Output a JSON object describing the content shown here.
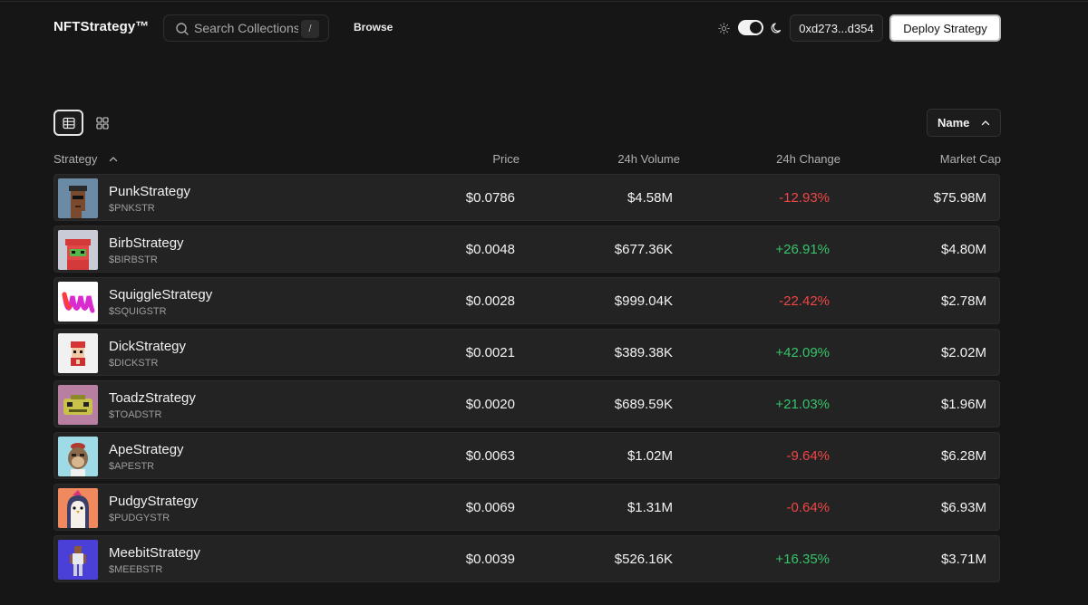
{
  "header": {
    "brand": "NFTStrategy™",
    "search_placeholder": "Search Collections",
    "search_shortcut": "/",
    "browse_label": "Browse",
    "wallet_address": "0xd273...d354",
    "deploy_label": "Deploy Strategy",
    "theme_dark": true
  },
  "toolbar": {
    "sort_label": "Name",
    "view_mode": "table"
  },
  "table": {
    "columns": {
      "strategy": "Strategy",
      "price": "Price",
      "volume": "24h Volume",
      "change": "24h Change",
      "market_cap": "Market Cap"
    },
    "rows": [
      {
        "name": "PunkStrategy",
        "ticker": "$PNKSTR",
        "price": "$0.0786",
        "volume": "$4.58M",
        "change": "-12.93%",
        "direction": "down",
        "market_cap": "$75.98M",
        "avatar_icon": "cryptopunk-avatar-icon",
        "avatar_bg": "#6b8aa6"
      },
      {
        "name": "BirbStrategy",
        "ticker": "$BIRBSTR",
        "price": "$0.0048",
        "volume": "$677.36K",
        "change": "+26.91%",
        "direction": "up",
        "market_cap": "$4.80M",
        "avatar_icon": "birb-avatar-icon",
        "avatar_bg": "#c9ccd6"
      },
      {
        "name": "SquiggleStrategy",
        "ticker": "$SQUIGSTR",
        "price": "$0.0028",
        "volume": "$999.04K",
        "change": "-22.42%",
        "direction": "down",
        "market_cap": "$2.78M",
        "avatar_icon": "squiggle-avatar-icon",
        "avatar_bg": "#ffffff"
      },
      {
        "name": "DickStrategy",
        "ticker": "$DICKSTR",
        "price": "$0.0021",
        "volume": "$389.38K",
        "change": "+42.09%",
        "direction": "up",
        "market_cap": "$2.02M",
        "avatar_icon": "dick-avatar-icon",
        "avatar_bg": "#f1f1f1"
      },
      {
        "name": "ToadzStrategy",
        "ticker": "$TOADSTR",
        "price": "$0.0020",
        "volume": "$689.59K",
        "change": "+21.03%",
        "direction": "up",
        "market_cap": "$1.96M",
        "avatar_icon": "toadz-avatar-icon",
        "avatar_bg": "#b87fa3"
      },
      {
        "name": "ApeStrategy",
        "ticker": "$APESTR",
        "price": "$0.0063",
        "volume": "$1.02M",
        "change": "-9.64%",
        "direction": "down",
        "market_cap": "$6.28M",
        "avatar_icon": "ape-avatar-icon",
        "avatar_bg": "#9fdbe6"
      },
      {
        "name": "PudgyStrategy",
        "ticker": "$PUDGYSTR",
        "price": "$0.0069",
        "volume": "$1.31M",
        "change": "-0.64%",
        "direction": "down",
        "market_cap": "$6.93M",
        "avatar_icon": "pudgy-penguin-avatar-icon",
        "avatar_bg": "#f08a5e"
      },
      {
        "name": "MeebitStrategy",
        "ticker": "$MEEBSTR",
        "price": "$0.0039",
        "volume": "$526.16K",
        "change": "+16.35%",
        "direction": "up",
        "market_cap": "$3.71M",
        "avatar_icon": "meebit-avatar-icon",
        "avatar_bg": "#4a3fd6"
      }
    ]
  },
  "colors": {
    "background": "#161616",
    "row_background": "#232323",
    "negative": "#f04646",
    "positive": "#35c46a"
  }
}
